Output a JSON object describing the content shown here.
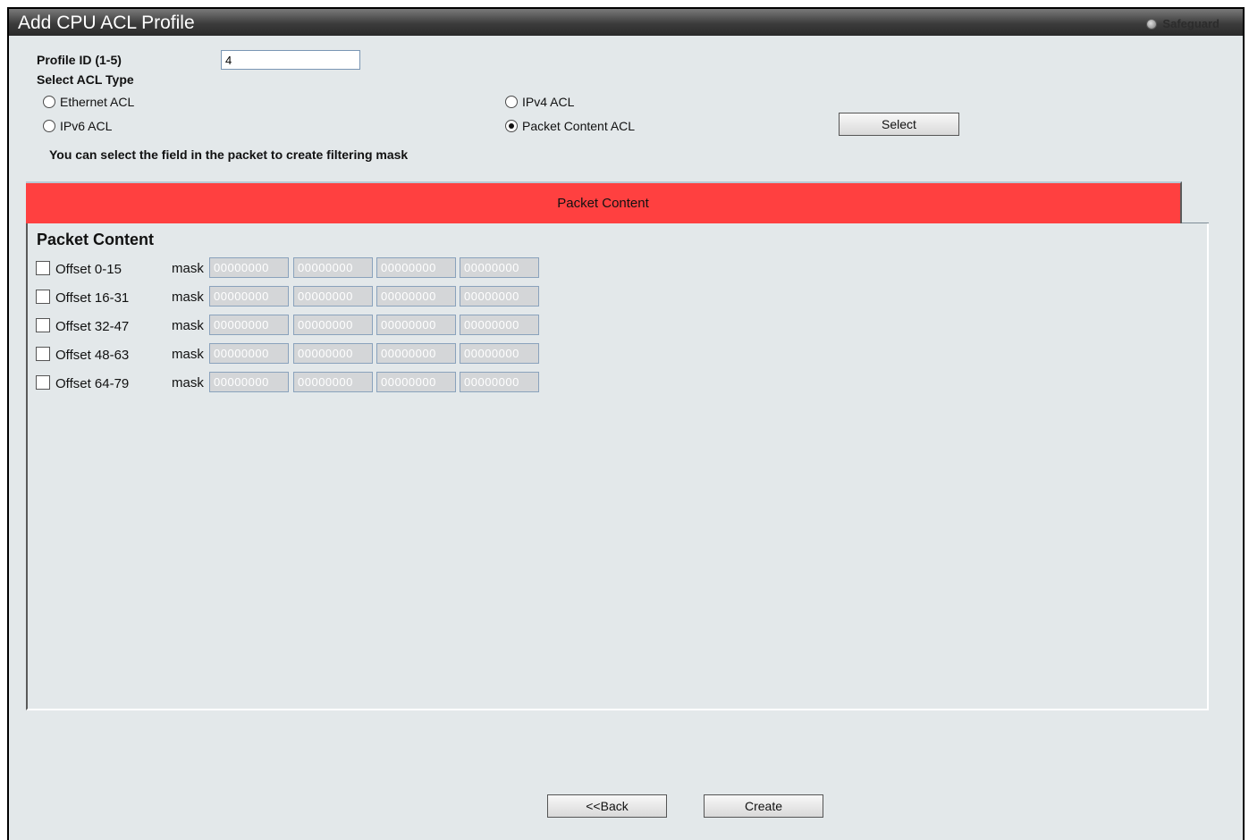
{
  "header": {
    "title": "Add CPU ACL Profile",
    "safeguard": "Safeguard"
  },
  "form": {
    "profile_id_label": "Profile ID (1-5)",
    "profile_id_value": "4",
    "select_acl_type_label": "Select ACL Type",
    "acl_types": [
      {
        "label": "Ethernet ACL",
        "selected": false
      },
      {
        "label": "IPv4 ACL",
        "selected": false
      },
      {
        "label": "IPv6 ACL",
        "selected": false
      },
      {
        "label": "Packet Content ACL",
        "selected": true
      }
    ],
    "select_button": "Select",
    "hint": "You can select the field in the packet to create filtering mask"
  },
  "tab": {
    "label": "Packet Content"
  },
  "panel": {
    "title": "Packet Content",
    "mask_label": "mask",
    "offsets": [
      {
        "label": "Offset 0-15",
        "checked": false,
        "masks": [
          "00000000",
          "00000000",
          "00000000",
          "00000000"
        ]
      },
      {
        "label": "Offset 16-31",
        "checked": false,
        "masks": [
          "00000000",
          "00000000",
          "00000000",
          "00000000"
        ]
      },
      {
        "label": "Offset 32-47",
        "checked": false,
        "masks": [
          "00000000",
          "00000000",
          "00000000",
          "00000000"
        ]
      },
      {
        "label": "Offset 48-63",
        "checked": false,
        "masks": [
          "00000000",
          "00000000",
          "00000000",
          "00000000"
        ]
      },
      {
        "label": "Offset 64-79",
        "checked": false,
        "masks": [
          "00000000",
          "00000000",
          "00000000",
          "00000000"
        ]
      }
    ]
  },
  "footer": {
    "back_button": "<<Back",
    "create_button": "Create"
  }
}
